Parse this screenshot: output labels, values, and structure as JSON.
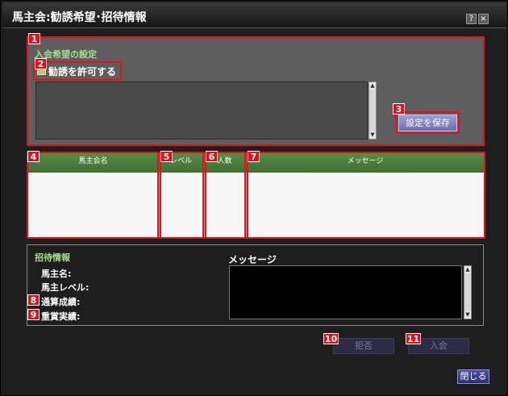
{
  "window": {
    "title": "馬主会:勧誘希望･招待情報",
    "help_label": "?",
    "close_label": "×"
  },
  "markers": [
    "1",
    "2",
    "3",
    "4",
    "5",
    "6",
    "7",
    "8",
    "9",
    "10",
    "11"
  ],
  "settings": {
    "section_title": "入会希望の設定",
    "checkbox_label": "勧誘を許可する",
    "message_value": "",
    "save_label": "設定を保存"
  },
  "table": {
    "columns": [
      "馬主会名",
      "レベル",
      "人数",
      "メッセージ"
    ],
    "rows": []
  },
  "invite": {
    "section_title": "招待情報",
    "owner_name_label": "馬主名:",
    "owner_level_label": "馬主レベル:",
    "total_results_label": "通算成績:",
    "grade_results_label": "重賞実績:",
    "message_title": "メッセージ",
    "message_value": ""
  },
  "buttons": {
    "decline_label": "拒否",
    "join_label": "入会",
    "close_label": "閉じる"
  },
  "colors": {
    "accent_red": "#e0121b",
    "section_green": "#a6e08a",
    "header_green": "#4f7f3f"
  },
  "scroll_arrows": {
    "up": "▲",
    "down": "▼"
  }
}
